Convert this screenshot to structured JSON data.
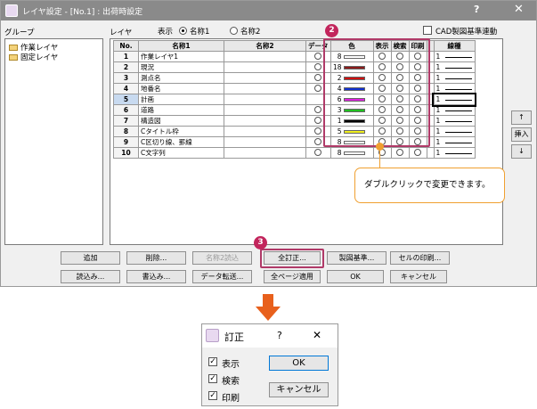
{
  "window": {
    "title": "レイヤ設定 - [No.1] : 出荷時設定",
    "help": "?",
    "close": "✕"
  },
  "group_label": "グループ",
  "layer_label": "レイヤ",
  "display_label": "表示",
  "radio_name1": "名称1",
  "radio_name2": "名称2",
  "cad_link_label": "CAD製図基準連動",
  "groups": [
    "作業レイヤ",
    "固定レイヤ"
  ],
  "columns": [
    "No.",
    "名称1",
    "名称2",
    "データ",
    "色",
    "表示",
    "検索",
    "印刷",
    "線種"
  ],
  "layers": [
    {
      "no": "1",
      "name1": "作業レイヤ1",
      "name2": "",
      "color_num": "8",
      "color": "#ffffff",
      "line": "1"
    },
    {
      "no": "2",
      "name1": "現況",
      "name2": "",
      "color_num": "18",
      "color": "#8b1a1a",
      "line": "1"
    },
    {
      "no": "3",
      "name1": "測点名",
      "name2": "",
      "color_num": "2",
      "color": "#d01010",
      "line": "1"
    },
    {
      "no": "4",
      "name1": "地番名",
      "name2": "",
      "color_num": "4",
      "color": "#1030d0",
      "line": "1"
    },
    {
      "no": "5",
      "name1": "計画",
      "name2": "",
      "color_num": "6",
      "color": "#e020e0",
      "line": "1"
    },
    {
      "no": "6",
      "name1": "道路",
      "name2": "",
      "color_num": "3",
      "color": "#20c020",
      "line": "1"
    },
    {
      "no": "7",
      "name1": "構造図",
      "name2": "",
      "color_num": "1",
      "color": "#000000",
      "line": "1"
    },
    {
      "no": "8",
      "name1": "Cタイトル枠",
      "name2": "",
      "color_num": "5",
      "color": "#f0f020",
      "line": "1"
    },
    {
      "no": "9",
      "name1": "C区切り線、罫線",
      "name2": "",
      "color_num": "8",
      "color": "#ffffff",
      "line": "1"
    },
    {
      "no": "10",
      "name1": "C文字列",
      "name2": "",
      "color_num": "8",
      "color": "#ffffff",
      "line": "1"
    }
  ],
  "side_buttons": {
    "up": "↑",
    "insert": "挿入",
    "down": "↓"
  },
  "callout_text": "ダブルクリックで変更できます。",
  "badges": {
    "b2": "2",
    "b3": "3"
  },
  "buttons": {
    "add": "追加",
    "delete": "削除...",
    "name2_read": "名称2読込",
    "bulk_fix": "全訂正...",
    "drawing_std": "製図基準...",
    "cell_print": "セルの印刷...",
    "load": "読込み...",
    "write": "書込み...",
    "data_transfer": "データ転送...",
    "apply_all": "全ページ適用",
    "ok": "OK",
    "cancel": "キャンセル"
  },
  "dialog": {
    "title": "訂正",
    "help": "?",
    "close": "✕",
    "options": [
      {
        "label": "表示",
        "checked": true
      },
      {
        "label": "検索",
        "checked": true
      },
      {
        "label": "印刷",
        "checked": true
      }
    ],
    "ok": "OK",
    "cancel": "キャンセル"
  },
  "accent_color": "#c2255c",
  "callout_border_color": "#f0a030",
  "arrow_color": "#e8601c"
}
